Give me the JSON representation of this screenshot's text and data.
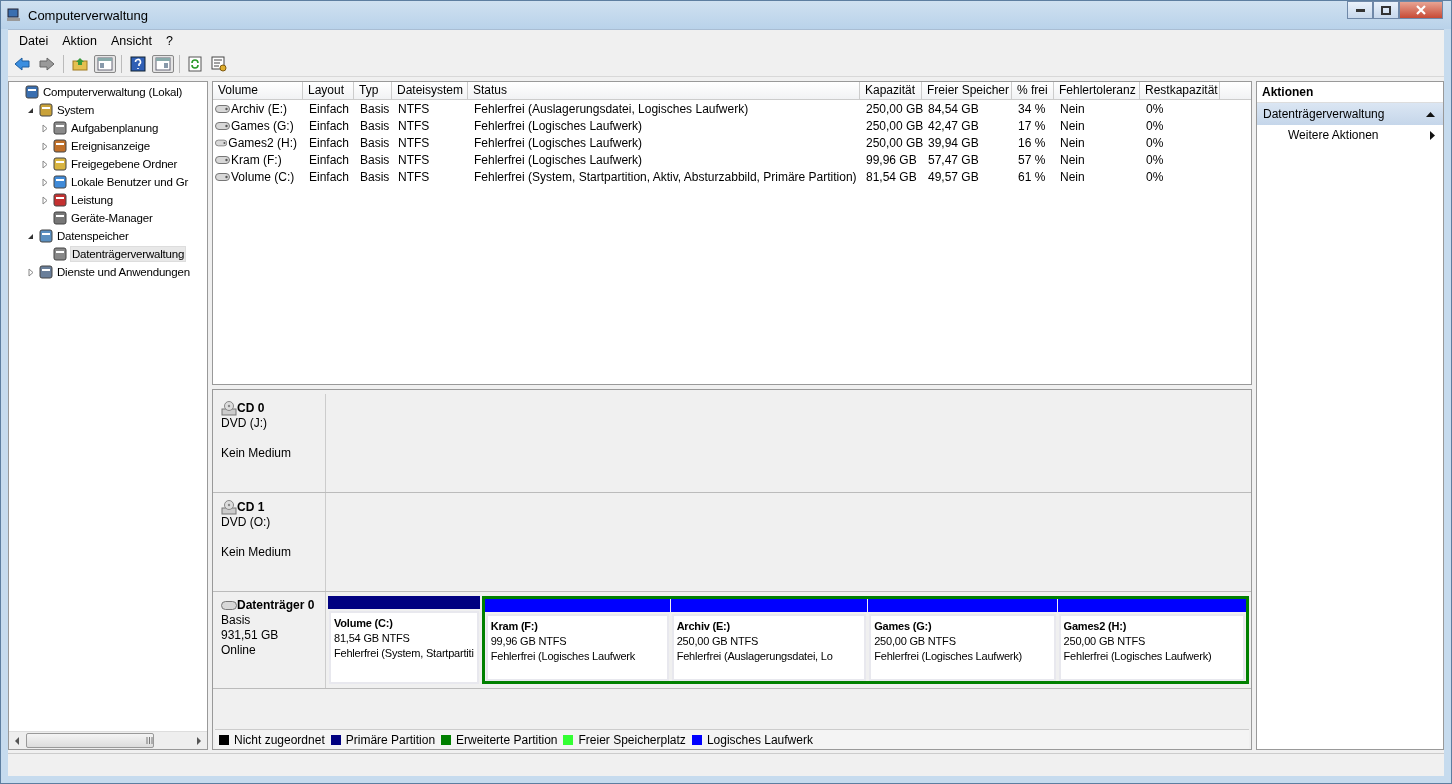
{
  "window": {
    "title": "Computerverwaltung"
  },
  "menu": [
    {
      "label": "Datei"
    },
    {
      "label": "Aktion"
    },
    {
      "label": "Ansicht"
    },
    {
      "label": "?"
    }
  ],
  "tree": [
    {
      "label": "Computerverwaltung (Lokal)",
      "selected": false,
      "children": [
        {
          "label": "System",
          "expanded": true,
          "selected": false,
          "children": [
            {
              "label": "Aufgabenplanung",
              "expanded": false,
              "selected": false
            },
            {
              "label": "Ereignisanzeige",
              "expanded": false,
              "selected": false
            },
            {
              "label": "Freigegebene Ordner",
              "expanded": false,
              "selected": false
            },
            {
              "label": "Lokale Benutzer und Gr",
              "expanded": false,
              "selected": false
            },
            {
              "label": "Leistung",
              "expanded": false,
              "selected": false
            },
            {
              "label": "Geräte-Manager",
              "selected": false
            }
          ]
        },
        {
          "label": "Datenspeicher",
          "expanded": true,
          "selected": false,
          "children": [
            {
              "label": "Datenträgerverwaltung",
              "selected": true
            }
          ]
        },
        {
          "label": "Dienste und Anwendungen",
          "expanded": false,
          "selected": false
        }
      ]
    }
  ],
  "table": {
    "columns": [
      "Volume",
      "Layout",
      "Typ",
      "Dateisystem",
      "Status",
      "Kapazität",
      "Freier Speicher",
      "% frei",
      "Fehlertoleranz",
      "Restkapazität"
    ],
    "rows": [
      {
        "cells": [
          "Archiv (E:)",
          "Einfach",
          "Basis",
          "NTFS",
          "Fehlerfrei (Auslagerungsdatei, Logisches Laufwerk)",
          "250,00 GB",
          "84,54 GB",
          "34 %",
          "Nein",
          "0%"
        ]
      },
      {
        "cells": [
          "Games (G:)",
          "Einfach",
          "Basis",
          "NTFS",
          "Fehlerfrei (Logisches Laufwerk)",
          "250,00 GB",
          "42,47 GB",
          "17 %",
          "Nein",
          "0%"
        ]
      },
      {
        "cells": [
          "Games2 (H:)",
          "Einfach",
          "Basis",
          "NTFS",
          "Fehlerfrei (Logisches Laufwerk)",
          "250,00 GB",
          "39,94 GB",
          "16 %",
          "Nein",
          "0%"
        ]
      },
      {
        "cells": [
          "Kram (F:)",
          "Einfach",
          "Basis",
          "NTFS",
          "Fehlerfrei (Logisches Laufwerk)",
          "99,96 GB",
          "57,47 GB",
          "57 %",
          "Nein",
          "0%"
        ]
      },
      {
        "cells": [
          "Volume (C:)",
          "Einfach",
          "Basis",
          "NTFS",
          "Fehlerfrei (System, Startpartition, Aktiv, Absturzabbild, Primäre Partition)",
          "81,54 GB",
          "49,57 GB",
          "61 %",
          "Nein",
          "0%"
        ]
      }
    ]
  },
  "disks": [
    {
      "kind": "cd",
      "name": "CD 0",
      "type": "DVD (J:)",
      "status": "Kein Medium"
    },
    {
      "kind": "cd",
      "name": "CD 1",
      "type": "DVD (O:)",
      "status": "Kein Medium"
    },
    {
      "kind": "disk",
      "name": "Datenträger 0",
      "type": "Basis",
      "size": "931,51 GB",
      "status": "Online",
      "partitions": [
        {
          "kind": "primary",
          "color": "#000080",
          "name": "Volume  (C:)",
          "size": "81,54 GB NTFS",
          "status": "Fehlerfrei (System, Startpartiti"
        },
        {
          "kind": "extended",
          "color": "#008000",
          "partitions": [
            {
              "kind": "logical",
              "color": "#0000ff",
              "name": "Kram  (F:)",
              "size": "99,96 GB NTFS",
              "status": "Fehlerfrei (Logisches Laufwerk"
            },
            {
              "kind": "logical",
              "color": "#0000ff",
              "name": "Archiv  (E:)",
              "size": "250,00 GB NTFS",
              "status": "Fehlerfrei (Auslagerungsdatei, Lo"
            },
            {
              "kind": "logical",
              "color": "#0000ff",
              "name": "Games  (G:)",
              "size": "250,00 GB NTFS",
              "status": "Fehlerfrei (Logisches Laufwerk)"
            },
            {
              "kind": "logical",
              "color": "#0000ff",
              "name": "Games2  (H:)",
              "size": "250,00 GB NTFS",
              "status": "Fehlerfrei (Logisches Laufwerk)"
            }
          ]
        }
      ]
    }
  ],
  "legend": [
    {
      "label": "Nicht zugeordnet",
      "color": "#000000"
    },
    {
      "label": "Primäre Partition",
      "color": "#000080"
    },
    {
      "label": "Erweiterte Partition",
      "color": "#008000"
    },
    {
      "label": "Freier Speicherplatz",
      "color": "#33ff33"
    },
    {
      "label": "Logisches Laufwerk",
      "color": "#0000ff"
    }
  ],
  "actions": {
    "title": "Aktionen",
    "sections": [
      {
        "label": "Datenträgerverwaltung",
        "expanded": true,
        "items": [
          {
            "label": "Weitere Aktionen"
          }
        ]
      }
    ]
  }
}
